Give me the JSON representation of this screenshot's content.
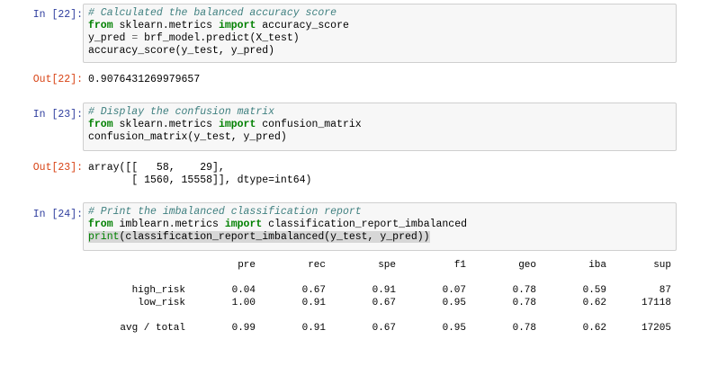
{
  "cells": [
    {
      "in_prompt": "In [22]:",
      "code": [
        {
          "tokens": [
            {
              "t": "# Calculated the balanced accuracy score",
              "c": "comment"
            }
          ]
        },
        {
          "tokens": [
            {
              "t": "from",
              "c": "kw"
            },
            {
              "t": " sklearn.metrics ",
              "c": ""
            },
            {
              "t": "import",
              "c": "kw"
            },
            {
              "t": " accuracy_score",
              "c": ""
            }
          ]
        },
        {
          "tokens": [
            {
              "t": "y_pred ",
              "c": ""
            },
            {
              "t": "=",
              "c": "op"
            },
            {
              "t": " brf_model.predict(X_test)",
              "c": ""
            }
          ]
        },
        {
          "tokens": [
            {
              "t": "accuracy_score(y_test, y_pred)",
              "c": ""
            }
          ]
        }
      ],
      "out_prompt": "Out[22]:",
      "output": "0.9076431269979657"
    },
    {
      "in_prompt": "In [23]:",
      "code": [
        {
          "tokens": [
            {
              "t": "# Display the confusion matrix",
              "c": "comment"
            }
          ]
        },
        {
          "tokens": [
            {
              "t": "from",
              "c": "kw"
            },
            {
              "t": " sklearn.metrics ",
              "c": ""
            },
            {
              "t": "import",
              "c": "kw"
            },
            {
              "t": " confusion_matrix",
              "c": ""
            }
          ]
        },
        {
          "tokens": [
            {
              "t": "confusion_matrix(y_test, y_pred)",
              "c": ""
            }
          ]
        }
      ],
      "out_prompt": "Out[23]:",
      "output": "array([[   58,    29],\n       [ 1560, 15558]], dtype=int64)"
    },
    {
      "in_prompt": "In [24]:",
      "code": [
        {
          "tokens": [
            {
              "t": "# Print the imbalanced classification report",
              "c": "comment"
            }
          ]
        },
        {
          "tokens": [
            {
              "t": "from",
              "c": "kw"
            },
            {
              "t": " imblearn.metrics ",
              "c": ""
            },
            {
              "t": "import",
              "c": "kw"
            },
            {
              "t": " classification_report_imbalanced",
              "c": ""
            }
          ]
        },
        {
          "tokens": [
            {
              "t": "print",
              "c": "fn sel"
            },
            {
              "t": "(classification_report_imbalanced(y_test, y_pred))",
              "c": "sel"
            }
          ]
        }
      ]
    }
  ],
  "report": {
    "headers": [
      "",
      "pre",
      "rec",
      "spe",
      "f1",
      "geo",
      "iba",
      "sup"
    ],
    "rows": [
      [
        "high_risk",
        "0.04",
        "0.67",
        "0.91",
        "0.07",
        "0.78",
        "0.59",
        "87"
      ],
      [
        "low_risk",
        "1.00",
        "0.91",
        "0.67",
        "0.95",
        "0.78",
        "0.62",
        "17118"
      ]
    ],
    "total": [
      "avg / total",
      "0.99",
      "0.91",
      "0.67",
      "0.95",
      "0.78",
      "0.62",
      "17205"
    ]
  }
}
